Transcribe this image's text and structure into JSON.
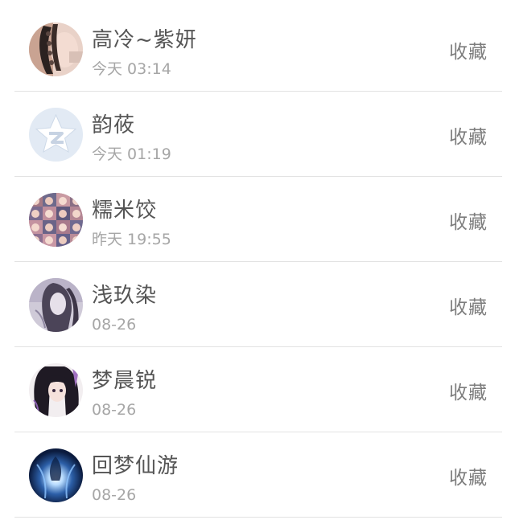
{
  "items": [
    {
      "name": "高冷~紫妍",
      "time": "今天 03:14",
      "action": "收藏",
      "avatar": "braided-hair-portrait-avatar"
    },
    {
      "name": "韵莜",
      "time": "今天 01:19",
      "action": "收藏",
      "avatar": "default-star-avatar"
    },
    {
      "name": "糯米饺",
      "time": "昨天 19:55",
      "action": "收藏",
      "avatar": "photo-collage-avatar"
    },
    {
      "name": "浅玖染",
      "time": "08-26",
      "action": "收藏",
      "avatar": "sketch-portrait-avatar"
    },
    {
      "name": "梦晨锐",
      "time": "08-26",
      "action": "收藏",
      "avatar": "anime-girl-avatar"
    },
    {
      "name": "回梦仙游",
      "time": "08-26",
      "action": "收藏",
      "avatar": "glowing-figure-avatar"
    }
  ]
}
